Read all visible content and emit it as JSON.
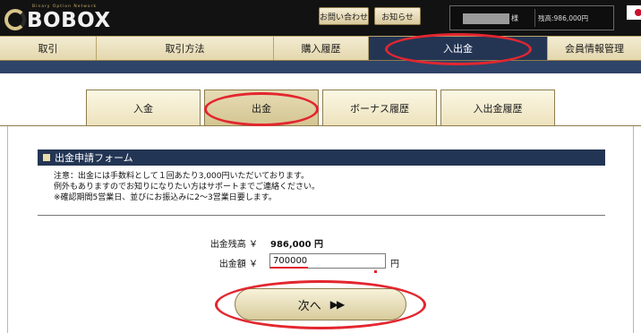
{
  "header": {
    "logo_subtitle": "Binary Option Network",
    "logo_text": "BOBOX",
    "buttons": {
      "contact": "お問い合わせ",
      "news": "お知らせ"
    },
    "user_suffix": "様",
    "balance_label": "残高:986,000円"
  },
  "nav": {
    "items": [
      {
        "label": "取引"
      },
      {
        "label": "取引方法"
      },
      {
        "label": "購入履歴"
      },
      {
        "label": "入出金"
      },
      {
        "label": "会員情報管理"
      }
    ],
    "active_index": 3
  },
  "tabs": {
    "items": [
      {
        "label": "入金"
      },
      {
        "label": "出金"
      },
      {
        "label": "ボーナス履歴"
      },
      {
        "label": "入出金履歴"
      }
    ],
    "active_index": 1
  },
  "form": {
    "title": "出金申請フォーム",
    "notice": [
      "注意：出金には手数料として１回あたり3,000円いただいております。",
      "例外もありますのでお知りになりたい方はサポートまでご連絡ください。",
      "※確認期間5営業日、並びにお振込みに2～3営業日要します。"
    ],
    "balance_label": "出金残高 ￥",
    "balance_value": "986,000 円",
    "amount_label": "出金額 ￥",
    "amount_value": "700000",
    "amount_unit": "円",
    "next_label": "次へ",
    "next_arrows": "▶▶"
  },
  "colors": {
    "nav_active": "#243554",
    "highlight": "#e3262f",
    "beige": "#e4d7ad"
  }
}
